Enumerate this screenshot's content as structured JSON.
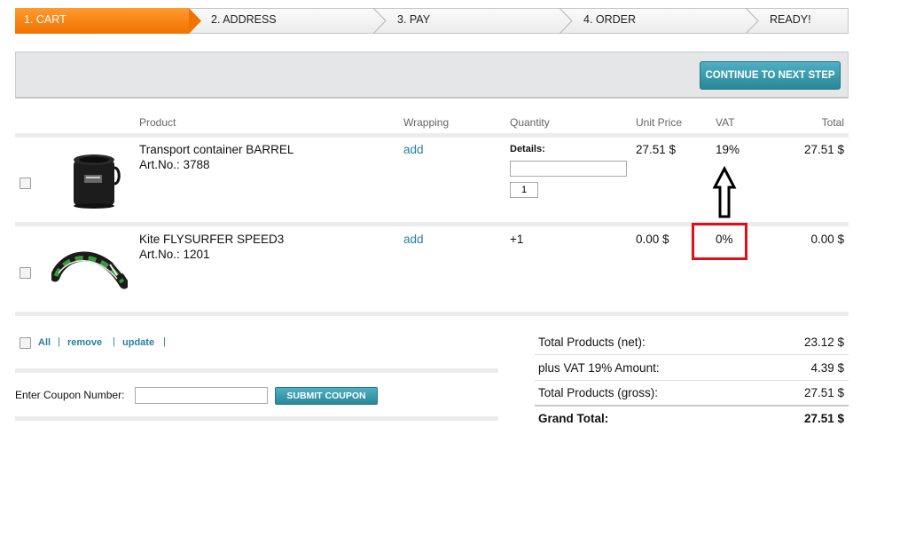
{
  "steps": [
    {
      "label": "1. CART",
      "active": true
    },
    {
      "label": "2. ADDRESS",
      "active": false
    },
    {
      "label": "3. PAY",
      "active": false
    },
    {
      "label": "4. ORDER",
      "active": false
    },
    {
      "label": "READY!",
      "active": false
    }
  ],
  "panel": {
    "continue_label": "CONTINUE TO NEXT STEP"
  },
  "table": {
    "headers": {
      "product": "Product",
      "wrapping": "Wrapping",
      "quantity": "Quantity",
      "unit_price": "Unit Price",
      "vat": "VAT",
      "total": "Total"
    },
    "rows": [
      {
        "name": "Transport container BARREL",
        "art": "Art.No.: 3788",
        "wrapping": "add",
        "details_label": "Details:",
        "details_value": "",
        "quantity": "1",
        "unit_price": "27.51 $",
        "vat": "19%",
        "total": "27.51 $"
      },
      {
        "name": "Kite FLYSURFER SPEED3",
        "art": "Art.No.: 1201",
        "wrapping": "add",
        "quantity": "+1",
        "unit_price": "0.00 $",
        "vat": "0%",
        "total": "0.00 $"
      }
    ]
  },
  "actions": {
    "all": "All",
    "remove": "remove",
    "update": "update",
    "pipe": "|"
  },
  "coupon": {
    "label": "Enter Coupon Number:",
    "value": "",
    "button": "SUBMIT COUPON"
  },
  "totals": [
    {
      "label": "Total Products (net):",
      "value": "23.12 $"
    },
    {
      "label": "plus VAT 19% Amount:",
      "value": "4.39 $"
    },
    {
      "label": "Total Products (gross):",
      "value": "27.51 $"
    },
    {
      "label": "Grand Total:",
      "value": "27.51 $"
    }
  ],
  "colors": {
    "accent": "#f07200",
    "button": "#2b8799",
    "link": "#2a7ea0",
    "annotation": "#e0101a"
  }
}
